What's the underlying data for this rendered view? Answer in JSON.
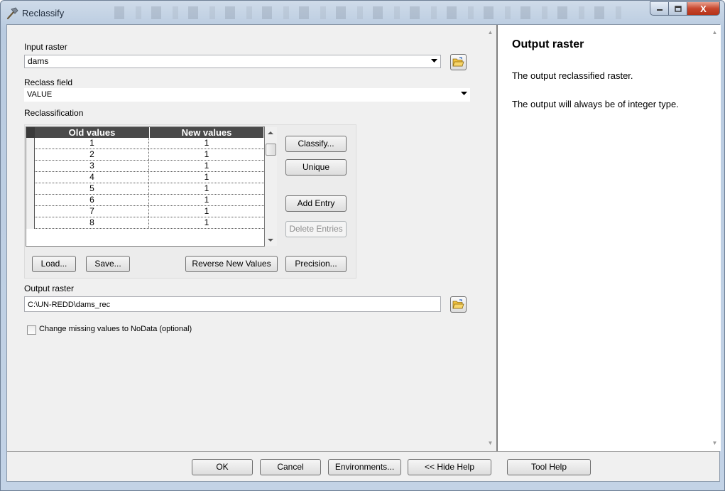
{
  "window": {
    "title": "Reclassify",
    "controls": {
      "minimize": "–",
      "maximize": "□",
      "close": "X"
    }
  },
  "form": {
    "input_raster": {
      "label": "Input raster",
      "value": "dams"
    },
    "reclass_field": {
      "label": "Reclass field",
      "value": "VALUE"
    },
    "reclassification": {
      "label": "Reclassification",
      "columns": [
        "Old values",
        "New values"
      ],
      "rows": [
        {
          "old": "1",
          "new": "1"
        },
        {
          "old": "2",
          "new": "1"
        },
        {
          "old": "3",
          "new": "1"
        },
        {
          "old": "4",
          "new": "1"
        },
        {
          "old": "5",
          "new": "1"
        },
        {
          "old": "6",
          "new": "1"
        },
        {
          "old": "7",
          "new": "1"
        },
        {
          "old": "8",
          "new": "1"
        }
      ],
      "buttons": {
        "classify": "Classify...",
        "unique": "Unique",
        "add_entry": "Add Entry",
        "delete_entries": "Delete Entries",
        "load": "Load...",
        "save": "Save...",
        "reverse": "Reverse New Values",
        "precision": "Precision..."
      }
    },
    "output_raster": {
      "label": "Output raster",
      "value": "C:\\UN-REDD\\dams_rec"
    },
    "missing_nodata": {
      "label": "Change missing values to NoData (optional)",
      "checked": false
    }
  },
  "help": {
    "title": "Output raster",
    "paragraphs": [
      "The output reclassified raster.",
      "The output will always be of integer type."
    ]
  },
  "bottom": {
    "ok": "OK",
    "cancel": "Cancel",
    "environments": "Environments...",
    "hide_help": "<< Hide Help",
    "tool_help": "Tool Help"
  },
  "icons": {
    "title": "hammer-icon",
    "browse": "open-folder-icon"
  },
  "colors": {
    "grid_header": "#4a4a4a",
    "close_button": "#c7472e",
    "folder_icon": "#f2c23d"
  }
}
